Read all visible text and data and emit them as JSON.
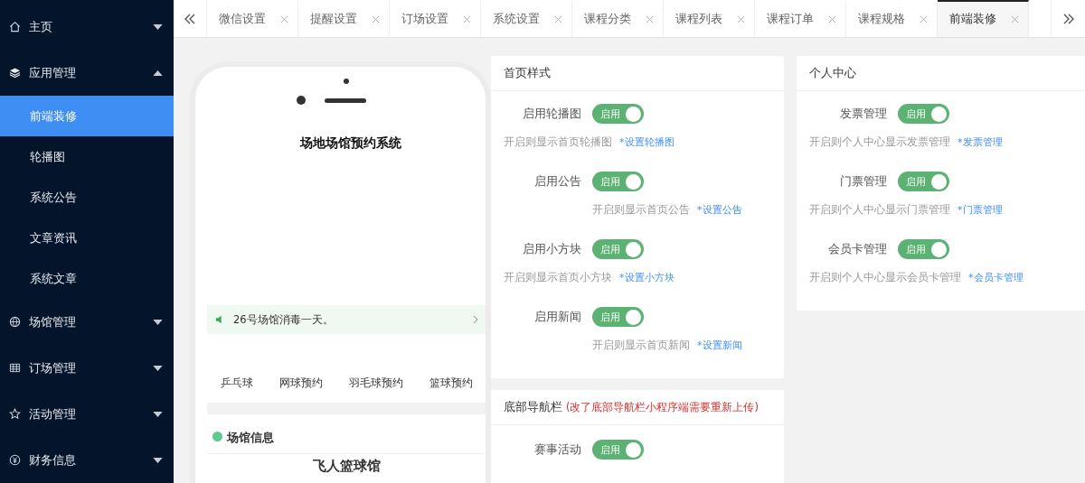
{
  "sidebar": {
    "items": [
      {
        "label": "主页",
        "expanded": false
      },
      {
        "label": "应用管理",
        "expanded": true,
        "children": [
          {
            "label": "前端装修",
            "selected": true
          },
          {
            "label": "轮播图",
            "selected": false
          },
          {
            "label": "系统公告",
            "selected": false
          },
          {
            "label": "文章资讯",
            "selected": false
          },
          {
            "label": "系统文章",
            "selected": false
          }
        ]
      },
      {
        "label": "场馆管理",
        "expanded": false
      },
      {
        "label": "订场管理",
        "expanded": false
      },
      {
        "label": "活动管理",
        "expanded": false
      },
      {
        "label": "财务信息",
        "expanded": false
      }
    ]
  },
  "tabs": [
    {
      "label": "微信设置",
      "selected": false
    },
    {
      "label": "提醒设置",
      "selected": false
    },
    {
      "label": "订场设置",
      "selected": false
    },
    {
      "label": "系统设置",
      "selected": false
    },
    {
      "label": "课程分类",
      "selected": false
    },
    {
      "label": "课程列表",
      "selected": false
    },
    {
      "label": "课程订单",
      "selected": false
    },
    {
      "label": "课程规格",
      "selected": false
    },
    {
      "label": "前端装修",
      "selected": true
    }
  ],
  "phone": {
    "title": "场地场馆预约系统",
    "notice": "26号场馆消毒一天。",
    "categories": [
      "乒乓球",
      "网球预约",
      "羽毛球预约",
      "篮球预约"
    ],
    "section_title": "场馆信息",
    "venue_name": "飞人篮球馆"
  },
  "home_style": {
    "title": "首页样式",
    "settings": [
      {
        "label": "启用轮播图",
        "toggle": {
          "text": "启用",
          "on": true
        },
        "hint": "开启则显示首页轮播图",
        "link": "*设置轮播图",
        "hint_indented": false
      },
      {
        "label": "启用公告",
        "toggle": {
          "text": "启用",
          "on": true
        },
        "hint": "开启则显示首页公告",
        "link": "*设置公告",
        "hint_indented": true
      },
      {
        "label": "启用小方块",
        "toggle": {
          "text": "启用",
          "on": true
        },
        "hint": "开启则显示首页小方块",
        "link": "*设置小方块",
        "hint_indented": false
      },
      {
        "label": "启用新闻",
        "toggle": {
          "text": "启用",
          "on": true
        },
        "hint": "开启则显示首页新闻",
        "link": "*设置新闻",
        "hint_indented": true
      }
    ]
  },
  "bottom_nav": {
    "title": "底部导航栏",
    "note": "(改了底部导航栏小程序端需要重新上传)",
    "settings": [
      {
        "label": "赛事活动",
        "toggle": {
          "text": "启用",
          "on": true
        }
      }
    ]
  },
  "personal_center": {
    "title": "个人中心",
    "settings": [
      {
        "label": "发票管理",
        "toggle": {
          "text": "启用",
          "on": true
        },
        "hint": "开启则个人中心显示发票管理",
        "link": "*发票管理",
        "hint_indented": false
      },
      {
        "label": "门票管理",
        "toggle": {
          "text": "启用",
          "on": true
        },
        "hint": "开启则个人中心显示门票管理",
        "link": "*门票管理",
        "hint_indented": false
      },
      {
        "label": "会员卡管理",
        "toggle": {
          "text": "启用",
          "on": true
        },
        "hint": "开启则个人中心显示会员卡管理",
        "link": "*会员卡管理",
        "hint_indented": false
      }
    ]
  }
}
